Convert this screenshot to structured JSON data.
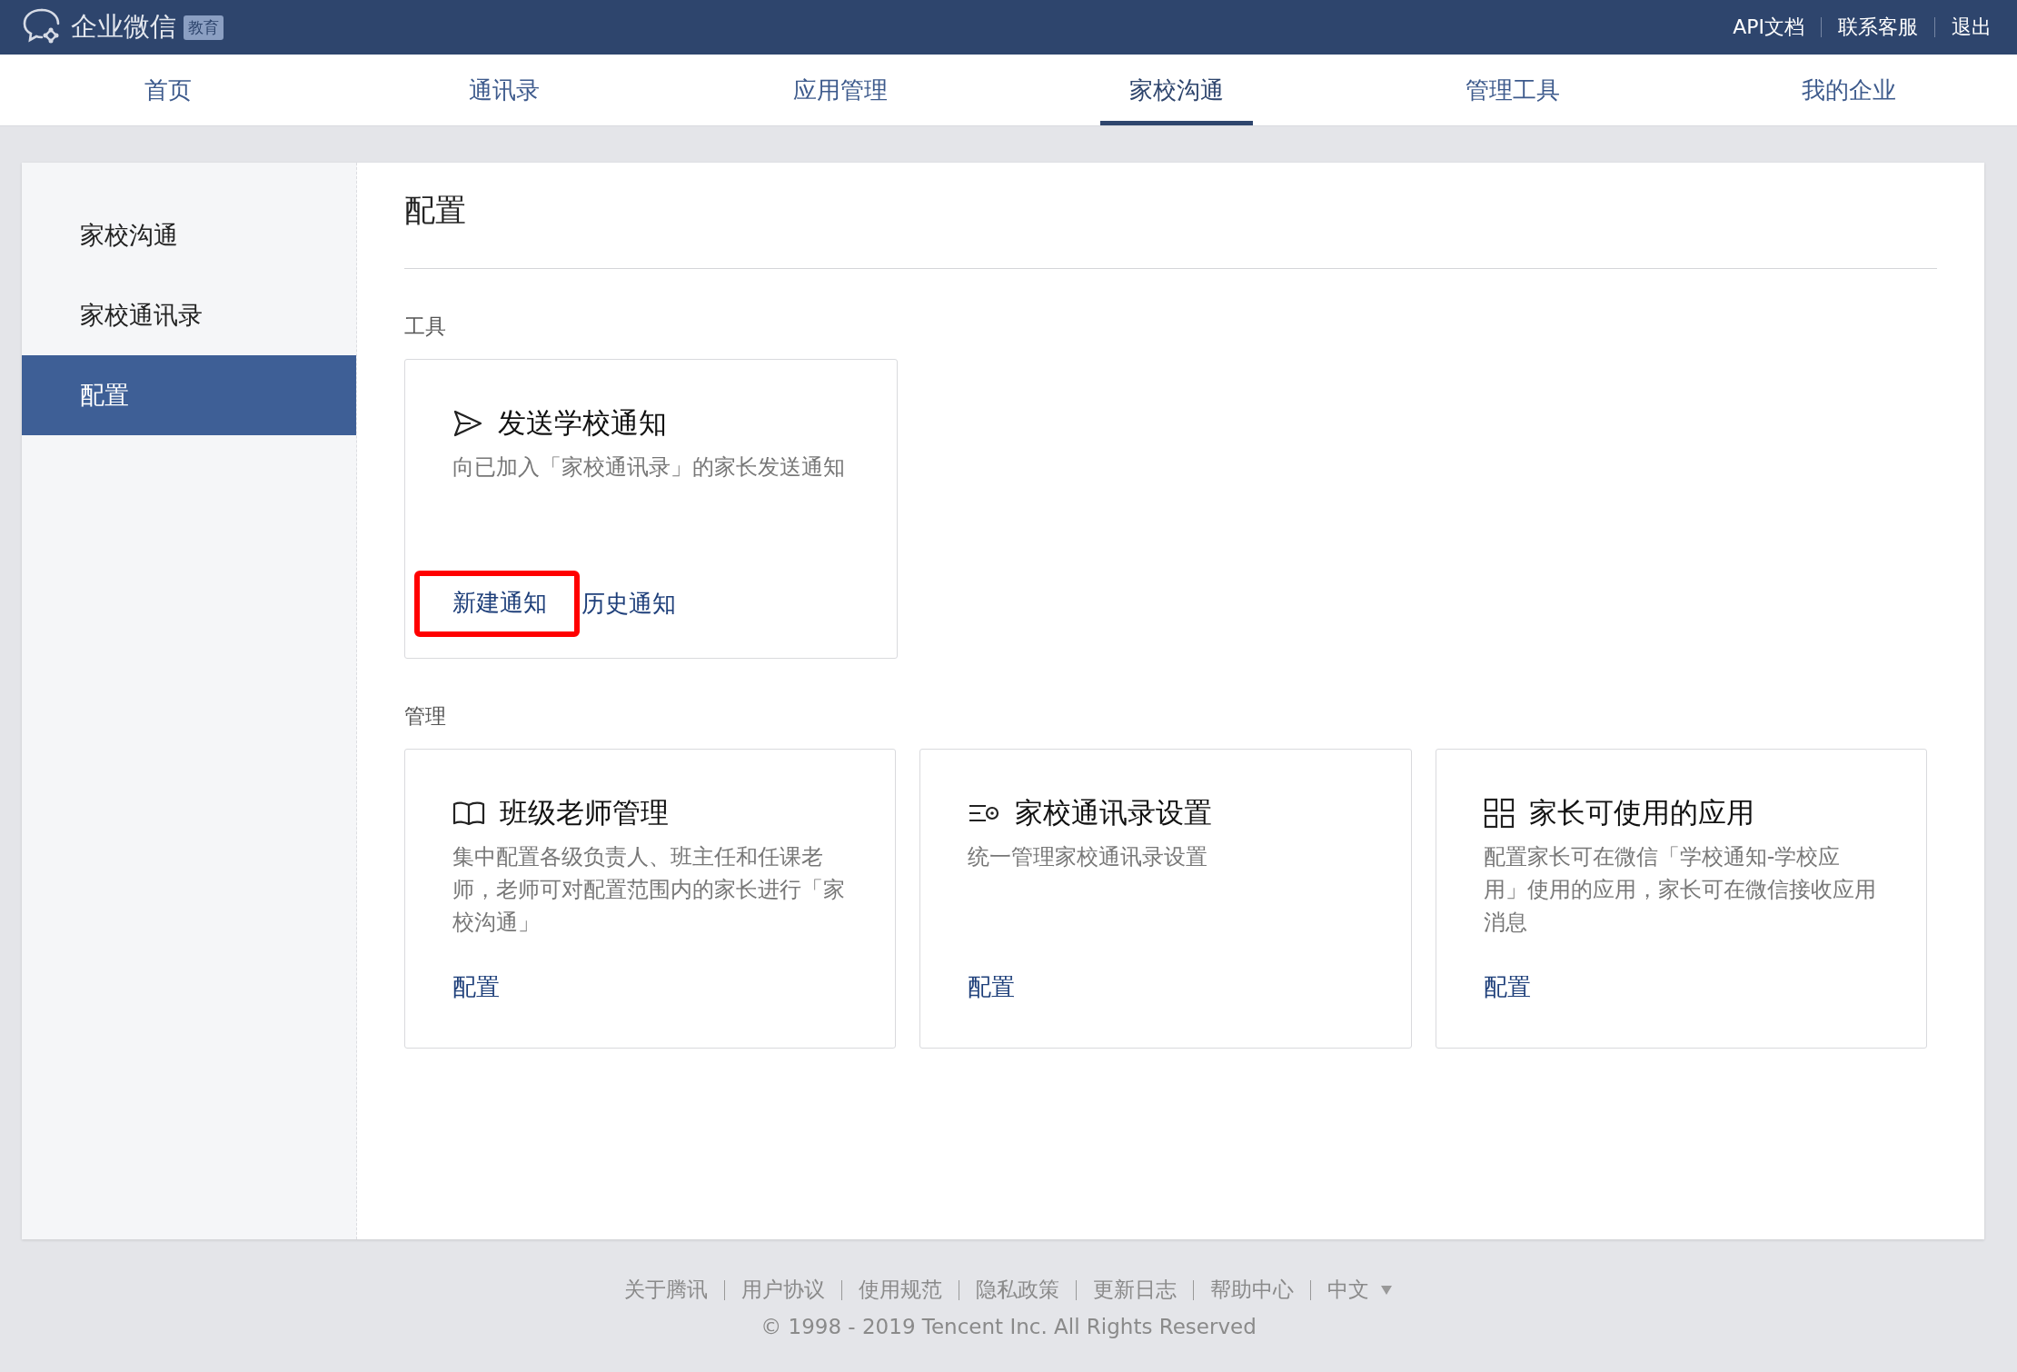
{
  "header": {
    "logo": "企业微信",
    "badge": "教育",
    "links": [
      "API文档",
      "联系客服",
      "退出"
    ]
  },
  "nav": [
    {
      "label": "首页",
      "selected": false
    },
    {
      "label": "通讯录",
      "selected": false
    },
    {
      "label": "应用管理",
      "selected": false
    },
    {
      "label": "家校沟通",
      "selected": true
    },
    {
      "label": "管理工具",
      "selected": false
    },
    {
      "label": "我的企业",
      "selected": false
    }
  ],
  "sidebar": [
    {
      "label": "家校沟通",
      "selected": false
    },
    {
      "label": "家校通讯录",
      "selected": false
    },
    {
      "label": "配置",
      "selected": true
    }
  ],
  "page": {
    "title": "配置",
    "sections": [
      {
        "title": "工具",
        "cards": [
          {
            "kind": "send",
            "title": "发送学校通知",
            "description": "向已加入「家校通讯录」的家长发送通知",
            "actions": [
              {
                "label": "新建通知",
                "highlighted": true
              },
              {
                "label": "历史通知",
                "highlighted": false
              }
            ]
          }
        ]
      },
      {
        "title": "管理",
        "cards": [
          {
            "kind": "book",
            "title": "班级老师管理",
            "description": "集中配置各级负责人、班主任和任课老师，老师可对配置范围内的家长进行「家校沟通」",
            "actions": [
              {
                "label": "配置",
                "highlighted": false
              }
            ]
          },
          {
            "kind": "list",
            "title": "家校通讯录设置",
            "description": "统一管理家校通讯录设置",
            "actions": [
              {
                "label": "配置",
                "highlighted": false
              }
            ]
          },
          {
            "kind": "grid",
            "title": "家长可使用的应用",
            "description": "配置家长可在微信「学校通知-学校应用」使用的应用，家长可在微信接收应用消息",
            "actions": [
              {
                "label": "配置",
                "highlighted": false
              }
            ]
          }
        ]
      }
    ]
  },
  "footer": {
    "links": [
      "关于腾讯",
      "用户协议",
      "使用规范",
      "隐私政策",
      "更新日志",
      "帮助中心"
    ],
    "language": "中文",
    "copyright": "© 1998 - 2019 Tencent Inc. All Rights Reserved"
  }
}
